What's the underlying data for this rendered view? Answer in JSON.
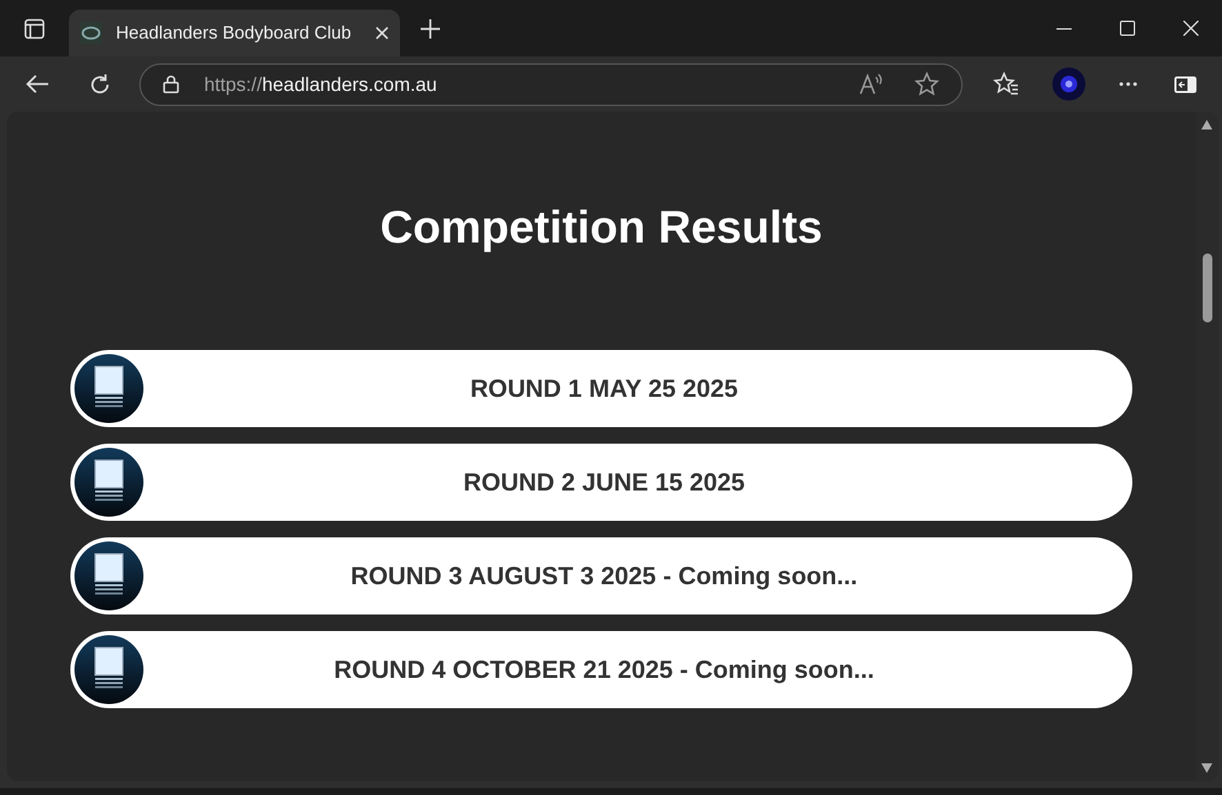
{
  "browser": {
    "tab": {
      "title": "Headlanders Bodyboard Club",
      "selected": true
    },
    "url": {
      "scheme": "https://",
      "host": "headlanders.com.au"
    }
  },
  "page": {
    "heading": "Competition Results",
    "results": [
      {
        "label": "ROUND 1 MAY 25 2025"
      },
      {
        "label": "ROUND 2 JUNE 15 2025"
      },
      {
        "label": "ROUND 3 AUGUST 3 2025 - Coming soon..."
      },
      {
        "label": "ROUND 4 OCTOBER 21 2025 - Coming soon..."
      }
    ]
  }
}
